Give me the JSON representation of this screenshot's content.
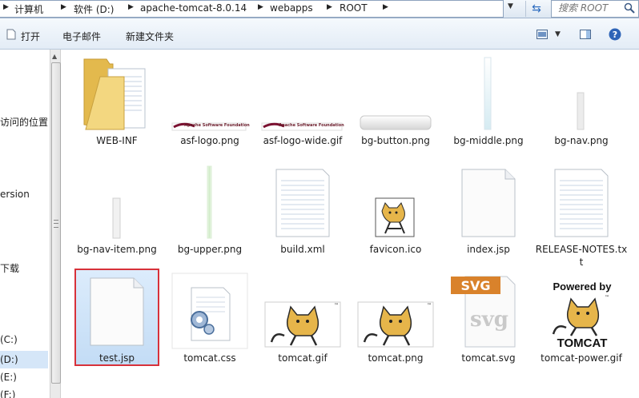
{
  "address": {
    "crumbs": [
      "计算机",
      "软件 (D:)",
      "apache-tomcat-8.0.14",
      "webapps",
      "ROOT"
    ]
  },
  "search": {
    "placeholder": "搜索 ROOT"
  },
  "toolbar": {
    "open": "打开",
    "email": "电子邮件",
    "new_folder": "新建文件夹"
  },
  "nav": {
    "items": [
      "访问的位置",
      "ersion",
      "下载",
      "(C:)",
      "(D:)",
      "(E:)",
      "(F:)"
    ]
  },
  "files": [
    {
      "name": "WEB-INF",
      "icon": "folder-icon"
    },
    {
      "name": "asf-logo.png",
      "icon": "image-icon"
    },
    {
      "name": "asf-logo-wide.gif",
      "icon": "image-icon"
    },
    {
      "name": "bg-button.png",
      "icon": "image-icon"
    },
    {
      "name": "bg-middle.png",
      "icon": "image-icon"
    },
    {
      "name": "bg-nav.png",
      "icon": "image-icon"
    },
    {
      "name": "bg-nav-item.png",
      "icon": "image-icon"
    },
    {
      "name": "bg-upper.png",
      "icon": "image-icon"
    },
    {
      "name": "build.xml",
      "icon": "document-icon"
    },
    {
      "name": "favicon.ico",
      "icon": "tomcat-icon"
    },
    {
      "name": "index.jsp",
      "icon": "blank-file-icon"
    },
    {
      "name": "RELEASE-NOTES.txt",
      "icon": "document-icon"
    },
    {
      "name": "test.jsp",
      "icon": "blank-file-icon"
    },
    {
      "name": "tomcat.css",
      "icon": "css-file-icon"
    },
    {
      "name": "tomcat.gif",
      "icon": "tomcat-icon"
    },
    {
      "name": "tomcat.png",
      "icon": "tomcat-icon"
    },
    {
      "name": "tomcat.svg",
      "icon": "svg-file-icon"
    },
    {
      "name": "tomcat-power.gif",
      "icon": "tomcat-power-icon"
    }
  ],
  "thumb_text": {
    "asf": "Apache Software Foundation",
    "svg": "SVG",
    "svg_watermark": "svg",
    "powered_by": "Powered by",
    "tomcat": "TOMCAT"
  },
  "colors": {
    "selection_border": "#d7313a",
    "selection_fill": "#cfe3f8",
    "folder": "#f2d27a"
  }
}
